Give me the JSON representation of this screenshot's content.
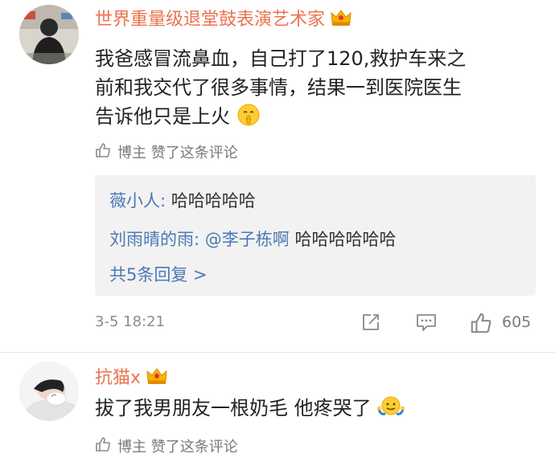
{
  "comment1": {
    "username": "世界重量级退堂鼓表演艺术家",
    "lines": [
      "我爸感冒流鼻血，自己打了120,救护车来之",
      "前和我交代了很多事情，结果一到医院医生",
      "告诉他只是上火"
    ],
    "liked_by": "博主 赞了这条评论",
    "replies": [
      {
        "name": "薇小人:",
        "text": "哈哈哈哈哈"
      },
      {
        "name": "刘雨晴的雨:",
        "mention": "@李子栋啊",
        "text": "哈哈哈哈哈哈"
      }
    ],
    "more_replies": "共5条回复 >",
    "time": "3-5 18:21",
    "likes": "605"
  },
  "comment2": {
    "username": "抗猫x",
    "text": "拔了我男朋友一根奶毛 他疼哭了",
    "liked_by": "博主 赞了这条评论"
  },
  "icons": {
    "vip": "crown-icon",
    "like": "thumbs-up-icon",
    "share": "share-icon",
    "reply": "comment-icon",
    "emoji1": "shushing-face-emoji",
    "emoji2": "shrug-emoji"
  },
  "colors": {
    "username": "#eb7350",
    "link": "#4b79b5",
    "meta": "#8c8c8c"
  }
}
